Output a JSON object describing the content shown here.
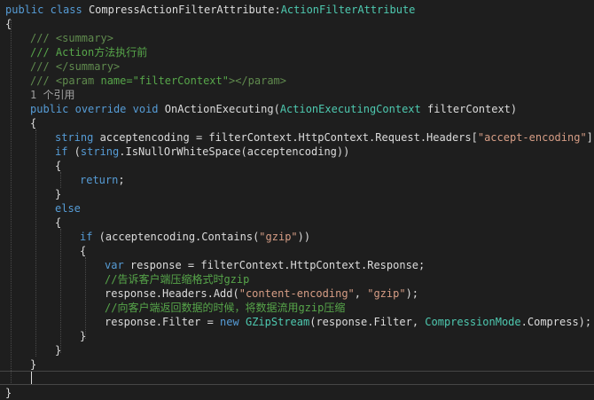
{
  "editor": {
    "lines": [
      [
        [
          "kw",
          "public"
        ],
        [
          "plain",
          " "
        ],
        [
          "kw",
          "class"
        ],
        [
          "plain",
          " CompressActionFilterAttribute:"
        ],
        [
          "type",
          "ActionFilterAttribute"
        ]
      ],
      [
        [
          "plain",
          "{"
        ]
      ],
      [
        [
          "xml",
          "/// <summary>"
        ]
      ],
      [
        [
          "cm",
          "/// Action方法执行前"
        ]
      ],
      [
        [
          "xml",
          "/// </summary>"
        ]
      ],
      [
        [
          "xml",
          "/// <param "
        ],
        [
          "cm",
          "name=\"filterContext\""
        ],
        [
          "xml",
          "></param>"
        ]
      ],
      [
        [
          "ref",
          "1 个引用"
        ]
      ],
      [
        [
          "kw",
          "public"
        ],
        [
          "plain",
          " "
        ],
        [
          "kw",
          "override"
        ],
        [
          "plain",
          " "
        ],
        [
          "kw",
          "void"
        ],
        [
          "plain",
          " OnActionExecuting("
        ],
        [
          "type",
          "ActionExecutingContext"
        ],
        [
          "plain",
          " filterContext)"
        ]
      ],
      [
        [
          "plain",
          "{"
        ]
      ],
      [
        [
          "kw",
          "string"
        ],
        [
          "plain",
          " acceptencoding = filterContext.HttpContext.Request.Headers["
        ],
        [
          "str",
          "\"accept-encoding\""
        ],
        [
          "plain",
          "];"
        ]
      ],
      [
        [
          "kw",
          "if"
        ],
        [
          "plain",
          " ("
        ],
        [
          "kw",
          "string"
        ],
        [
          "plain",
          ".IsNullOrWhiteSpace(acceptencoding))"
        ]
      ],
      [
        [
          "plain",
          "{"
        ]
      ],
      [
        [
          "kw",
          "return"
        ],
        [
          "plain",
          ";"
        ]
      ],
      [
        [
          "plain",
          "}"
        ]
      ],
      [
        [
          "kw",
          "else"
        ]
      ],
      [
        [
          "plain",
          "{"
        ]
      ],
      [
        [
          "kw",
          "if"
        ],
        [
          "plain",
          " (acceptencoding.Contains("
        ],
        [
          "str",
          "\"gzip\""
        ],
        [
          "plain",
          "))"
        ]
      ],
      [
        [
          "plain",
          "{"
        ]
      ],
      [
        [
          "kw",
          "var"
        ],
        [
          "plain",
          " response = filterContext.HttpContext.Response;"
        ]
      ],
      [
        [
          "cm",
          "//告诉客户端压缩格式时gzip"
        ]
      ],
      [
        [
          "plain",
          "response.Headers.Add("
        ],
        [
          "str",
          "\"content-encoding\""
        ],
        [
          "plain",
          ", "
        ],
        [
          "str",
          "\"gzip\""
        ],
        [
          "plain",
          ");"
        ]
      ],
      [
        [
          "cm",
          "//向客户端返回数据的时候，将数据流用gzip压缩"
        ]
      ],
      [
        [
          "plain",
          "response.Filter = "
        ],
        [
          "kw",
          "new"
        ],
        [
          "plain",
          " "
        ],
        [
          "type",
          "GZipStream"
        ],
        [
          "plain",
          "(response.Filter, "
        ],
        [
          "type",
          "CompressionMode"
        ],
        [
          "plain",
          ".Compress);"
        ]
      ],
      [
        [
          "plain",
          "}"
        ]
      ],
      [
        [
          "plain",
          "}"
        ]
      ],
      [
        [
          "plain",
          "}"
        ]
      ],
      [
        [
          "plain",
          ""
        ]
      ],
      [
        [
          "plain",
          "}"
        ]
      ]
    ]
  }
}
